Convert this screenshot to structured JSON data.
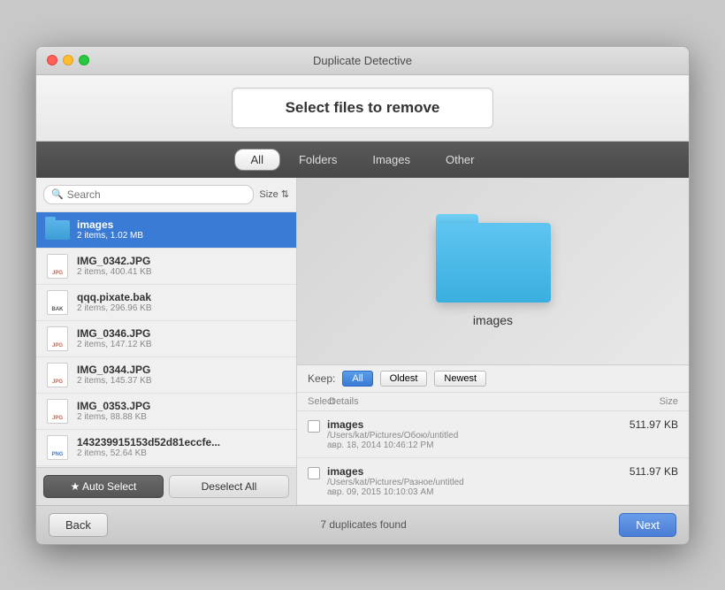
{
  "window": {
    "title": "Duplicate Detective"
  },
  "header": {
    "title": "Select files to remove"
  },
  "tabs": [
    {
      "label": "All",
      "active": true
    },
    {
      "label": "Folders",
      "active": false
    },
    {
      "label": "Images",
      "active": false
    },
    {
      "label": "Other",
      "active": false
    }
  ],
  "search": {
    "placeholder": "Search"
  },
  "sort": {
    "label": "Size"
  },
  "files": [
    {
      "name": "images",
      "meta": "2 items, 1.02 MB",
      "type": "folder",
      "selected": true
    },
    {
      "name": "IMG_0342.JPG",
      "meta": "2 items, 400.41 KB",
      "type": "jpg"
    },
    {
      "name": "qqq.pixate.bak",
      "meta": "2 items, 296.96 KB",
      "type": "bak"
    },
    {
      "name": "IMG_0346.JPG",
      "meta": "2 items, 147.12 KB",
      "type": "jpg"
    },
    {
      "name": "IMG_0344.JPG",
      "meta": "2 items, 145.37 KB",
      "type": "jpg"
    },
    {
      "name": "IMG_0353.JPG",
      "meta": "2 items, 88.88 KB",
      "type": "jpg"
    },
    {
      "name": "143239915153d52d81eccfe...",
      "meta": "2 items, 52.64 KB",
      "type": "png"
    }
  ],
  "buttons": {
    "auto_select": "★ Auto Select",
    "deselect_all": "Deselect All",
    "back": "Back",
    "next": "Next"
  },
  "preview": {
    "name": "images"
  },
  "keep": {
    "label": "Keep:",
    "options": [
      {
        "label": "All",
        "active": true
      },
      {
        "label": "Oldest",
        "active": false
      },
      {
        "label": "Newest",
        "active": false
      }
    ]
  },
  "details": {
    "header": {
      "select": "Select",
      "details": "Details",
      "size": "Size"
    },
    "duplicates": [
      {
        "name": "images",
        "path": "/Users/kat/Pictures/Обою/untitled",
        "date": "авр. 18, 2014  10:46:12 PM",
        "size": "511.97 KB",
        "checked": false
      },
      {
        "name": "images",
        "path": "/Users/kat/Pictures/Разное/untitled",
        "date": "авр. 09, 2015  10:10:03 AM",
        "size": "511.97 KB",
        "checked": false
      }
    ]
  },
  "footer": {
    "status": "7 duplicates found"
  }
}
